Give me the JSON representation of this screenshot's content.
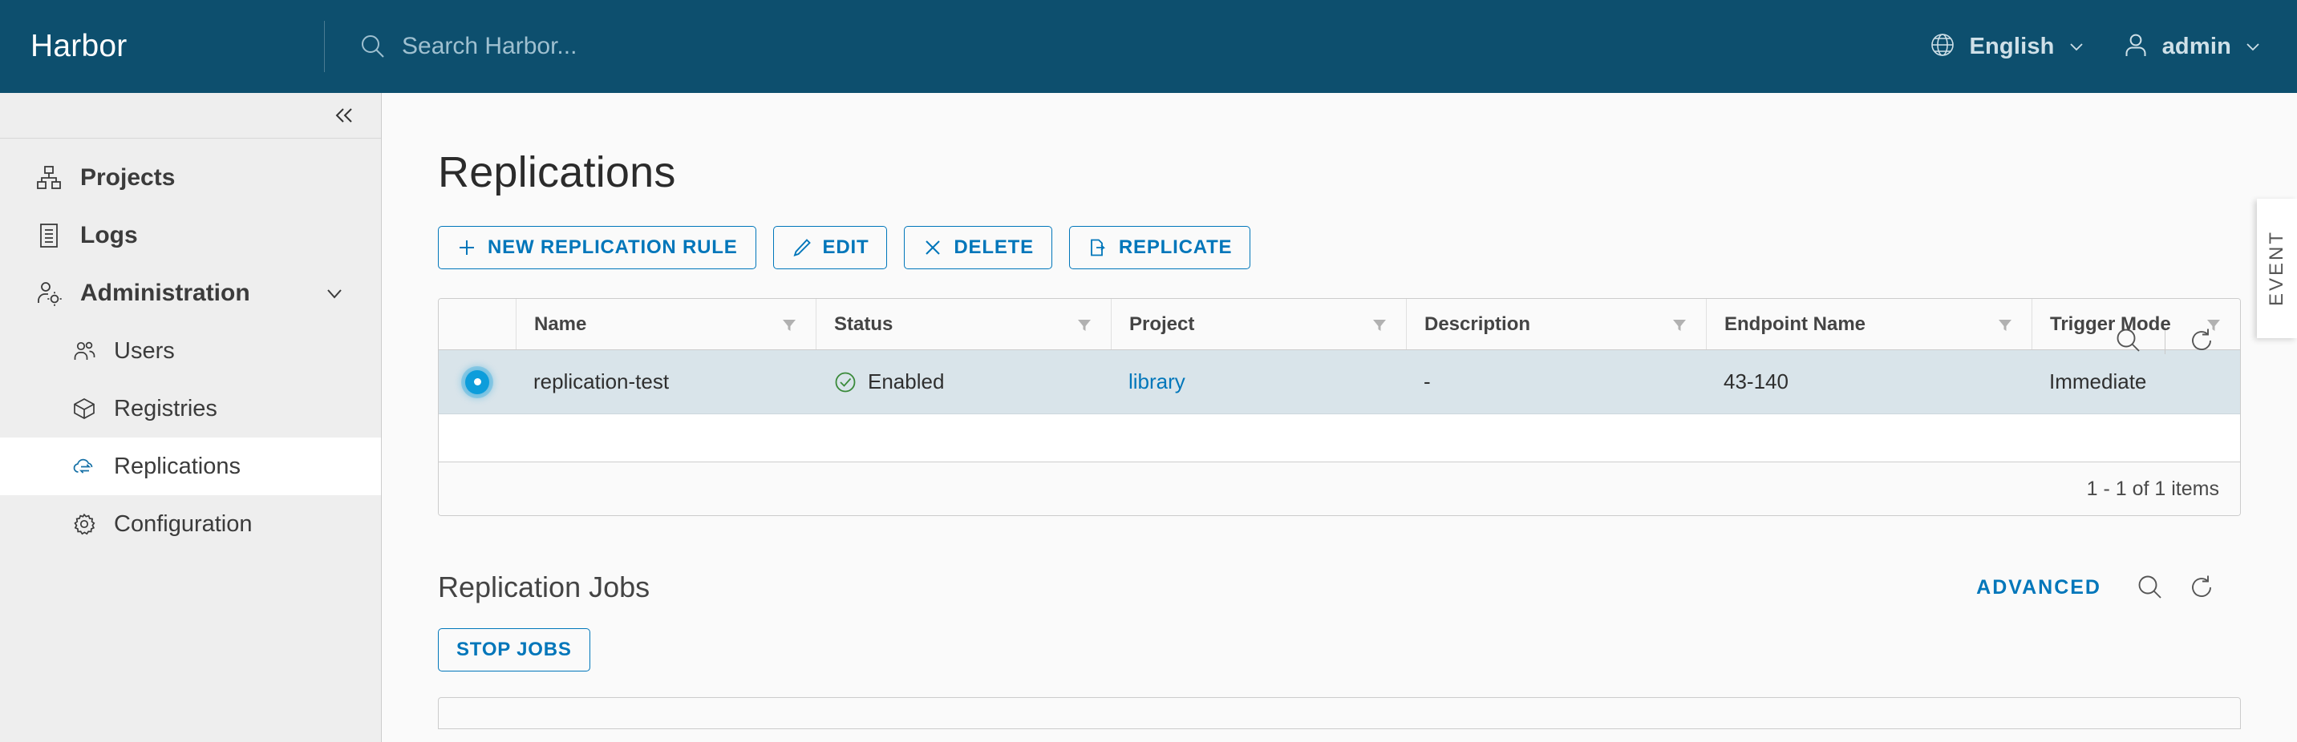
{
  "header": {
    "brand": "Harbor",
    "search_placeholder": "Search Harbor...",
    "search_icon": "search-icon",
    "language": "English",
    "language_icon": "globe-icon",
    "user": "admin",
    "user_icon": "user-icon",
    "caret_icon": "chevron-down-icon"
  },
  "sidebar": {
    "collapse_icon": "double-chevron-left-icon",
    "items": [
      {
        "label": "Projects",
        "icon": "projects-icon",
        "level": "top",
        "active": false,
        "expandable": false
      },
      {
        "label": "Logs",
        "icon": "logs-icon",
        "level": "top",
        "active": false,
        "expandable": false
      },
      {
        "label": "Administration",
        "icon": "administration-icon",
        "level": "top",
        "active": false,
        "expandable": true
      },
      {
        "label": "Users",
        "icon": "users-icon",
        "level": "sub",
        "active": false,
        "expandable": false
      },
      {
        "label": "Registries",
        "icon": "registries-icon",
        "level": "sub",
        "active": false,
        "expandable": false
      },
      {
        "label": "Replications",
        "icon": "replications-icon",
        "level": "sub",
        "active": true,
        "expandable": false
      },
      {
        "label": "Configuration",
        "icon": "configuration-icon",
        "level": "sub",
        "active": false,
        "expandable": false
      }
    ]
  },
  "main": {
    "title": "Replications",
    "buttons": [
      {
        "label": "NEW REPLICATION RULE",
        "icon": "plus-icon"
      },
      {
        "label": "EDIT",
        "icon": "pencil-icon"
      },
      {
        "label": "DELETE",
        "icon": "close-x-icon"
      },
      {
        "label": "REPLICATE",
        "icon": "replicate-icon"
      }
    ],
    "table_tools": {
      "search_icon": "search-icon",
      "refresh_icon": "refresh-icon"
    },
    "table": {
      "columns": [
        {
          "label": "Name",
          "filter": true
        },
        {
          "label": "Status",
          "filter": true
        },
        {
          "label": "Project",
          "filter": true
        },
        {
          "label": "Description",
          "filter": true
        },
        {
          "label": "Endpoint Name",
          "filter": true
        },
        {
          "label": "Trigger Mode",
          "filter": true
        }
      ],
      "rows": [
        {
          "selected": true,
          "name": "replication-test",
          "status": "Enabled",
          "status_icon": "check-circle-icon",
          "project": "library",
          "description": "-",
          "endpoint_name": "43-140",
          "trigger_mode": "Immediate"
        }
      ],
      "pagination": "1 - 1 of 1 items"
    }
  },
  "jobs": {
    "title": "Replication Jobs",
    "advanced_label": "ADVANCED",
    "search_icon": "search-icon",
    "refresh_icon": "refresh-icon",
    "stop_button": "STOP JOBS"
  },
  "event_panel": {
    "label": "EVENT"
  },
  "colors": {
    "header_bg": "#0d4f6e",
    "accent": "#0076ba",
    "sidebar_bg": "#eeeeee",
    "selected_row": "#d9e4ea",
    "status_green": "#3a8a3a",
    "radio_blue": "#0d9ddb"
  }
}
